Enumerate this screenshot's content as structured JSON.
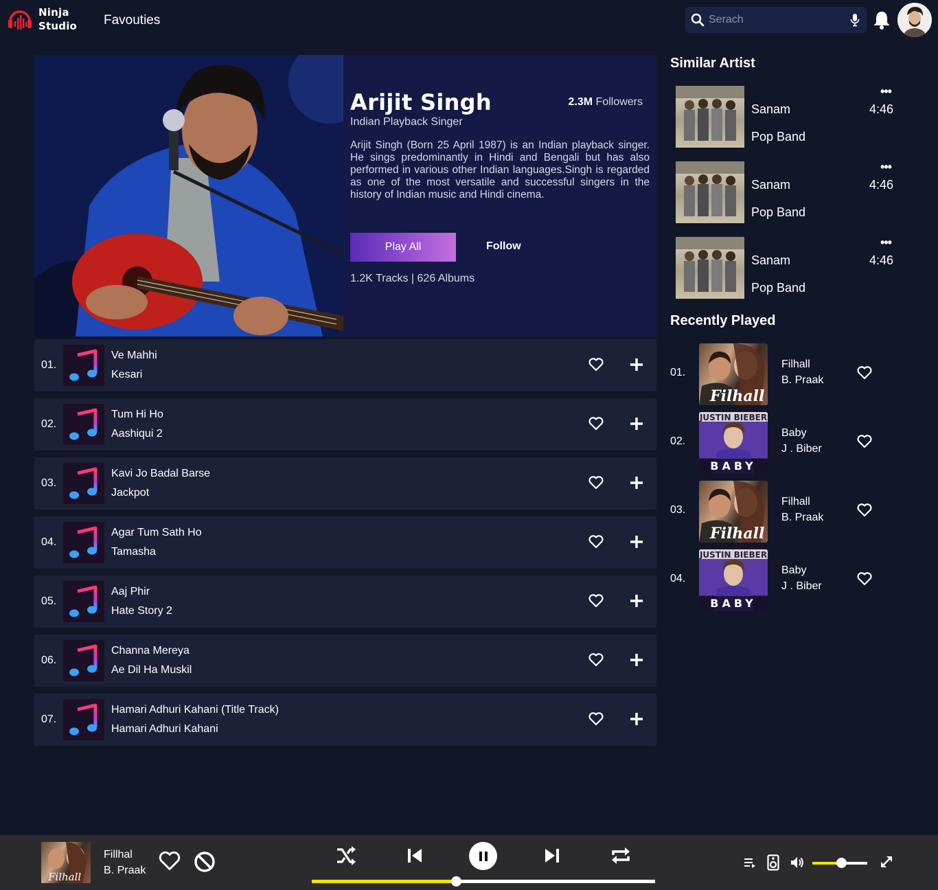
{
  "header": {
    "logo_line1": "Ninja",
    "logo_line2": "Studio",
    "nav_favourites": "Favouties",
    "search_placeholder": "Serach"
  },
  "artist": {
    "name": "Arijit Singh",
    "subtitle": "Indian Playback Singer",
    "followers_count": "2.3M",
    "followers_label": "Followers",
    "bio": "Arijit Singh (Born 25 April 1987) is an Indian playback singer. He sings predominantly in Hindi and Bengali but has also performed in various other Indian languages.Singh is regarded as one of the most versatile and successful singers in the history of Indian music and Hindi cinema.",
    "play_all_label": "Play All",
    "follow_label": "Follow",
    "stats": "1.2K Tracks | 626 Albums"
  },
  "tracks": [
    {
      "num": "01.",
      "title": "Ve Mahhi",
      "album": "Kesari"
    },
    {
      "num": "02.",
      "title": "Tum Hi Ho",
      "album": "Aashiqui 2"
    },
    {
      "num": "03.",
      "title": "Kavi Jo Badal Barse",
      "album": "Jackpot"
    },
    {
      "num": "04.",
      "title": "Agar Tum Sath Ho",
      "album": "Tamasha"
    },
    {
      "num": "05.",
      "title": "Aaj Phir",
      "album": "Hate Story 2"
    },
    {
      "num": "06.",
      "title": "Channa Mereya",
      "album": "Ae Dil Ha Muskil"
    },
    {
      "num": "07.",
      "title": "Hamari Adhuri Kahani (Title Track)",
      "album": "Hamari Adhuri Kahani"
    }
  ],
  "similar": {
    "title": "Similar Artist",
    "items": [
      {
        "name": "Sanam",
        "genre": "Pop Band",
        "duration": "4:46",
        "more": "•••"
      },
      {
        "name": "Sanam",
        "genre": "Pop Band",
        "duration": "4:46",
        "more": "•••"
      },
      {
        "name": "Sanam",
        "genre": "Pop Band",
        "duration": "4:46",
        "more": "•••"
      }
    ]
  },
  "recent": {
    "title": "Recently Played",
    "items": [
      {
        "num": "01.",
        "title": "Filhall",
        "artist": "B. Praak",
        "cover_text": "Filhall"
      },
      {
        "num": "02.",
        "title": "Baby",
        "artist": "J . Biber",
        "cover_text": "BABY",
        "cover_top": "JUSTIN BIEBER"
      },
      {
        "num": "03.",
        "title": "Filhall",
        "artist": "B. Praak",
        "cover_text": "Filhall"
      },
      {
        "num": "04.",
        "title": "Baby",
        "artist": "J . Biber",
        "cover_text": "BABY",
        "cover_top": "JUSTIN BIEBER"
      }
    ]
  },
  "player": {
    "title": "Fillhal",
    "artist": "B. Praak",
    "cover_text": "Filhall",
    "progress": 0.42,
    "volume": 0.52
  },
  "colors": {
    "background": "#121629",
    "accent_yellow": "#f2e600",
    "play_all_start": "#5a2bb8",
    "play_all_end": "#c46fe0",
    "logo_red": "#e8232f"
  }
}
